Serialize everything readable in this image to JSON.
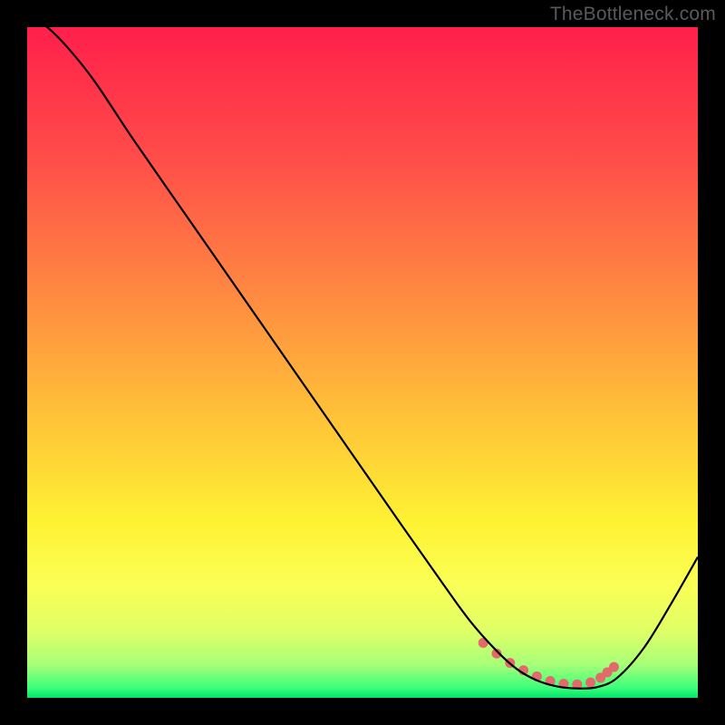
{
  "watermark": "TheBottleneck.com",
  "chart_data": {
    "type": "line",
    "title": "",
    "xlabel": "",
    "ylabel": "",
    "xlim": [
      0,
      100
    ],
    "ylim": [
      0,
      100
    ],
    "grid": false,
    "background_gradient": {
      "orientation": "vertical",
      "stops": [
        {
          "offset": 0.0,
          "color": "#ff1f4b"
        },
        {
          "offset": 0.2,
          "color": "#ff4e49"
        },
        {
          "offset": 0.4,
          "color": "#ff8a41"
        },
        {
          "offset": 0.58,
          "color": "#ffc238"
        },
        {
          "offset": 0.74,
          "color": "#fef233"
        },
        {
          "offset": 0.83,
          "color": "#fbff55"
        },
        {
          "offset": 0.9,
          "color": "#e0ff66"
        },
        {
          "offset": 0.95,
          "color": "#a8ff78"
        },
        {
          "offset": 0.985,
          "color": "#3dff7a"
        },
        {
          "offset": 1.0,
          "color": "#00e46a"
        }
      ]
    },
    "series": [
      {
        "name": "bottleneck-curve",
        "color": "#000000",
        "width": 2.2,
        "x": [
          0,
          3,
          6,
          10,
          16,
          24,
          32,
          40,
          48,
          56,
          62,
          66,
          70,
          73,
          76,
          79,
          82,
          85,
          88,
          92,
          96,
          100
        ],
        "y": [
          102,
          100,
          97,
          92,
          83,
          71.5,
          60,
          48.5,
          37,
          25.5,
          17,
          11.5,
          7,
          4.3,
          2.6,
          1.7,
          1.4,
          1.6,
          3.0,
          7.5,
          14,
          21
        ]
      }
    ],
    "highlight": {
      "name": "bottom-dots",
      "color": "#e36a6a",
      "radius": 5.5,
      "points_x": [
        68,
        70,
        72,
        74,
        76,
        78,
        80,
        82,
        84,
        85.5,
        86.5,
        87.5
      ],
      "points_y": [
        8.2,
        6.6,
        5.2,
        4.1,
        3.2,
        2.5,
        2.1,
        2.0,
        2.3,
        3.0,
        3.8,
        4.6
      ]
    }
  }
}
